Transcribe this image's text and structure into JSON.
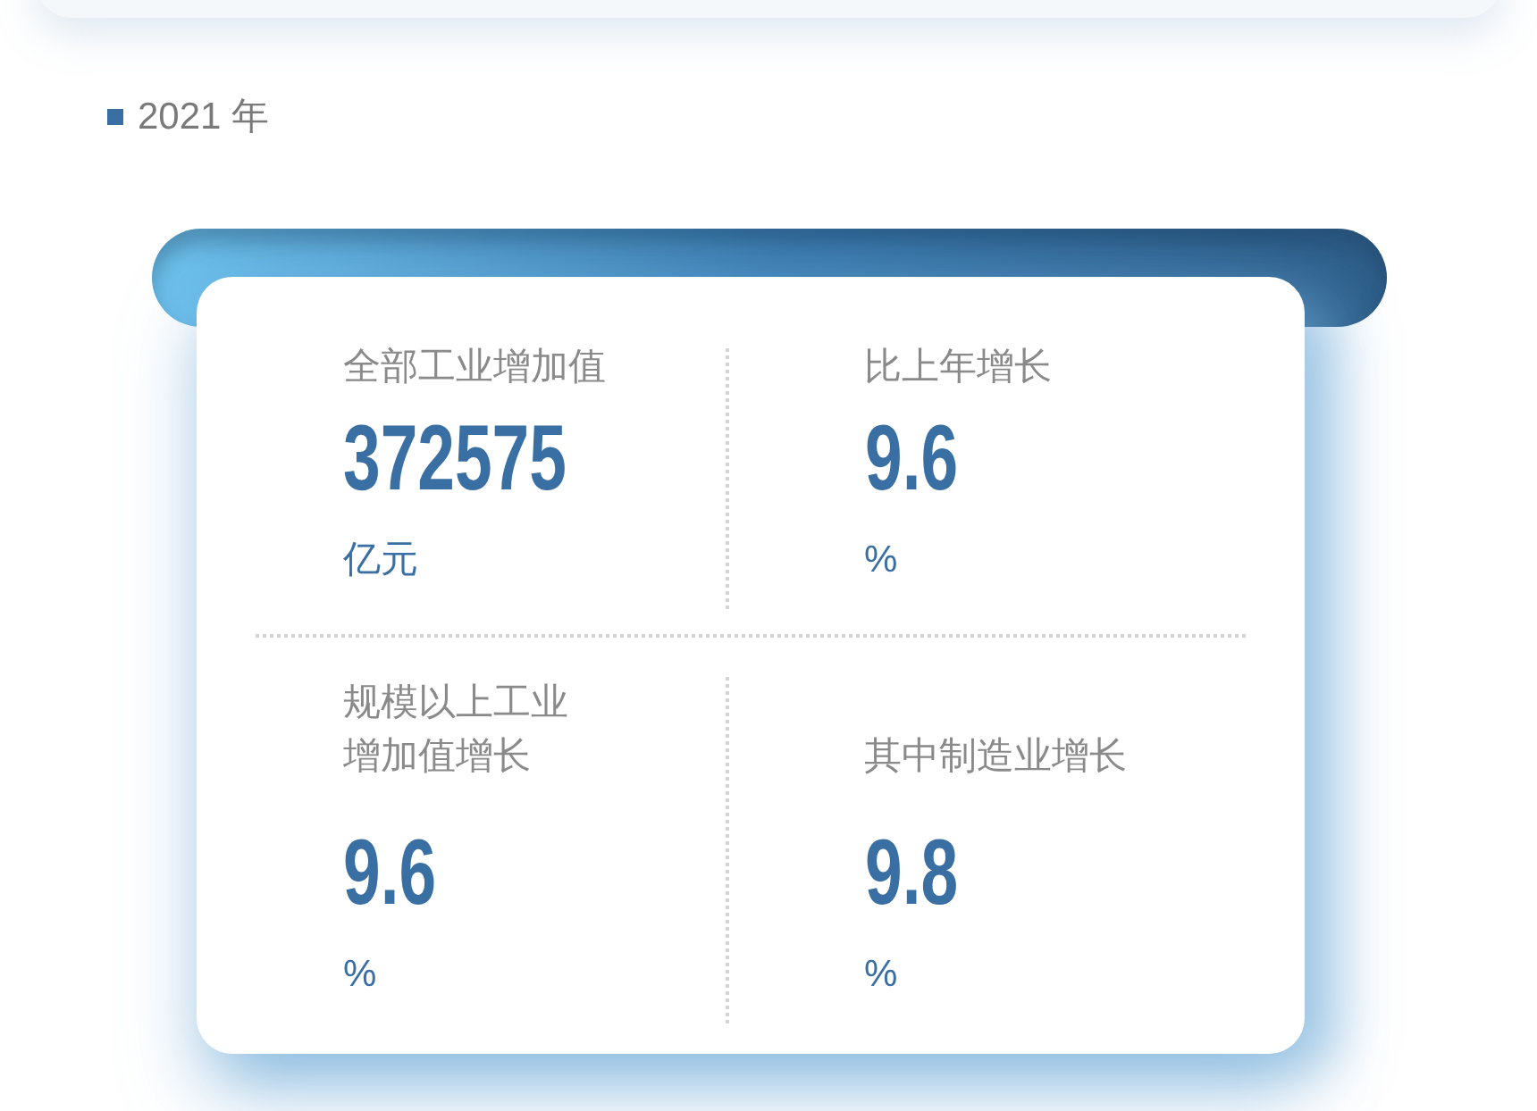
{
  "heading": "2021 年",
  "stats": [
    {
      "label": "全部工业增加值",
      "value": "372575",
      "unit": "亿元"
    },
    {
      "label": "比上年增长",
      "value": "9.6",
      "unit": "%"
    },
    {
      "label": "规模以上工业增加值增长",
      "value": "9.6",
      "unit": "%"
    },
    {
      "label": "其中制造业增长",
      "value": "9.8",
      "unit": "%"
    }
  ]
}
